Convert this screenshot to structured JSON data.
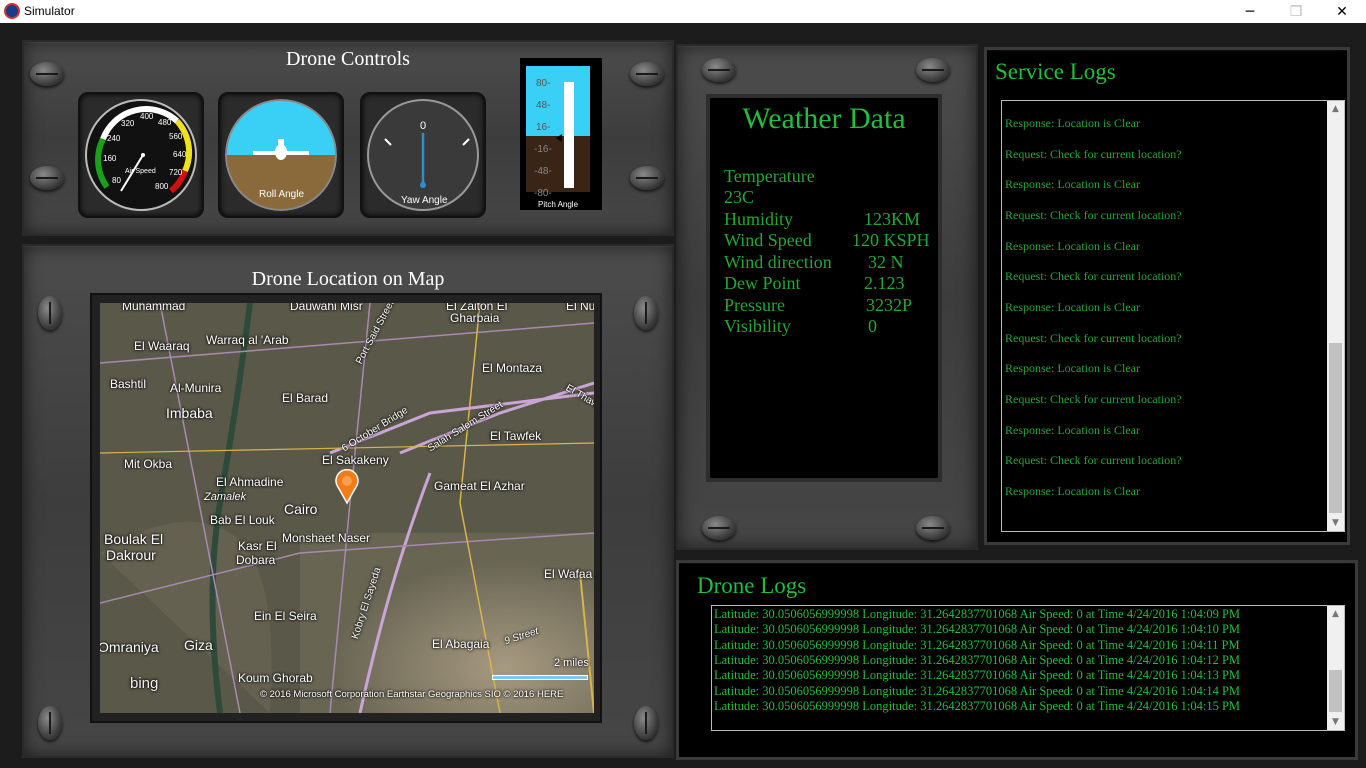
{
  "window": {
    "title": "Simulator",
    "minimize_glyph": "─",
    "maximize_glyph": "❐",
    "close_glyph": "✕"
  },
  "drone_controls": {
    "title": "Drone Controls",
    "air_speed": {
      "label": "Air Speed",
      "ticks": [
        "80",
        "160",
        "240",
        "320",
        "400",
        "480",
        "560",
        "640",
        "720",
        "800"
      ],
      "value": 0
    },
    "roll": {
      "label": "Roll Angle",
      "value": 0
    },
    "yaw": {
      "label": "Yaw Angle",
      "zero_label": "0",
      "value": 0
    },
    "pitch": {
      "label": "Pitch Angle",
      "ticks": [
        "80-",
        "48-",
        "16-",
        "-16-",
        "-48-",
        "-80-"
      ],
      "value": 0
    }
  },
  "map": {
    "title": "Drone Location on Map",
    "labels": [
      "Muhammad",
      "Dauwahi Misr",
      "El Zaiton El",
      "Gharbaia",
      "El Nu",
      "El Waaraq",
      "Warraq al 'Arab",
      "Port Said Street",
      "Bashtil",
      "Al-Munira",
      "El Montaza",
      "Imbaba",
      "El Barad",
      "El Thaw",
      "6 October Bridge",
      "Salah Salem Street",
      "El Tawfek",
      "Mit Okba",
      "El Sakakeny",
      "El Ahmadine",
      "Zamalek",
      "Gameat El Azhar",
      "Bab El Louk",
      "Cairo",
      "Boulak El",
      "Dakrour",
      "Kasr El",
      "Dobara",
      "Monshaet Naser",
      "El Wafaa",
      "Kobry El Sayeda",
      "Ein El Seira",
      "9 Street",
      "Omraniya",
      "Giza",
      "El Abagaia",
      "Koum Ghorab",
      "2 miles"
    ],
    "bing_logo": "bing",
    "copyright": "© 2016 Microsoft Corporation   Earthstar Geographics  SIO   © 2016 HERE"
  },
  "weather": {
    "title": "Weather Data",
    "temperature_label": "Temperature",
    "temperature_value": "23C",
    "rows": [
      {
        "label": "Humidity",
        "value": "123KM"
      },
      {
        "label": "Wind Speed",
        "value": "120 KSPH"
      },
      {
        "label": "Wind direction",
        "value": "32 N"
      },
      {
        "label": "Dew Point",
        "value": "2.123"
      },
      {
        "label": "Pressure",
        "value": "3232P"
      },
      {
        "label": "Visibility",
        "value": "0"
      }
    ]
  },
  "service_logs": {
    "title": "Service Logs",
    "lines": [
      "Response: Location is Clear",
      "Request: Check for current location?",
      "Response: Location is Clear",
      "Request: Check for current location?",
      "Response: Location is Clear",
      "Request: Check for current location?",
      "Response: Location is Clear",
      "Request: Check for current location?",
      "Response: Location is Clear",
      "Request: Check for current location?",
      "Response: Location is Clear",
      "Request: Check for current location?",
      "Response: Location is Clear"
    ],
    "scroll_up": "▲",
    "scroll_down": "▼"
  },
  "drone_logs": {
    "title": "Drone Logs",
    "lines": [
      "Latitude: 30.0506056999998 Longitude: 31.2642837701068 Air Speed: 0 at Time 4/24/2016 1:04:09 PM",
      "Latitude: 30.0506056999998 Longitude: 31.2642837701068 Air Speed: 0 at Time 4/24/2016 1:04:10 PM",
      "Latitude: 30.0506056999998 Longitude: 31.2642837701068 Air Speed: 0 at Time 4/24/2016 1:04:11 PM",
      "Latitude: 30.0506056999998 Longitude: 31.2642837701068 Air Speed: 0 at Time 4/24/2016 1:04:12 PM",
      "Latitude: 30.0506056999998 Longitude: 31.2642837701068 Air Speed: 0 at Time 4/24/2016 1:04:13 PM",
      "Latitude: 30.0506056999998 Longitude: 31.2642837701068 Air Speed: 0 at Time 4/24/2016 1:04:14 PM",
      "Latitude: 30.0506056999998 Longitude: 31.2642837701068 Air Speed: 0 at Time 4/24/2016 1:04:15 PM"
    ],
    "scroll_up": "▲",
    "scroll_down": "▼"
  },
  "colors": {
    "log_green": "#1fa832",
    "title_green": "#1fbf3a",
    "sky": "#3ad0f5",
    "ground": "#8a6a3a"
  }
}
